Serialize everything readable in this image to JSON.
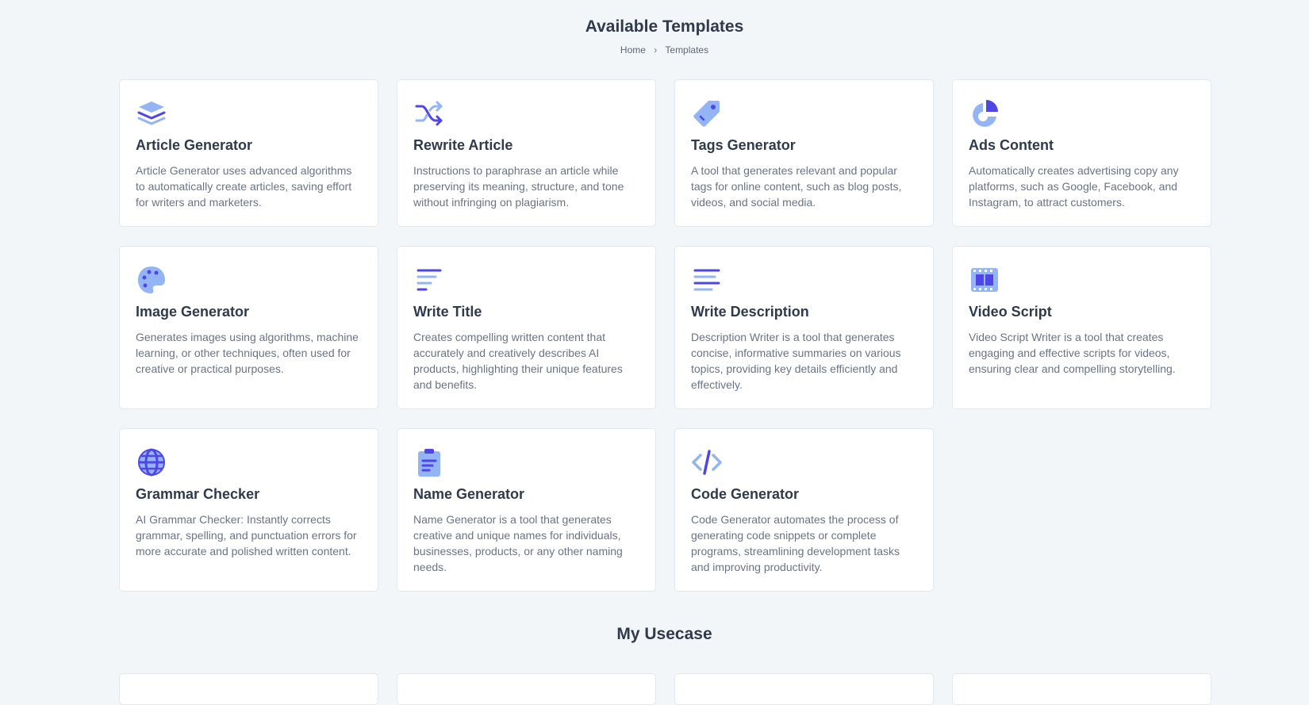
{
  "header": {
    "title": "Available Templates",
    "breadcrumb": {
      "home": "Home",
      "separator": "›",
      "current": "Templates"
    }
  },
  "colors": {
    "accent_dark": "#4f46e5",
    "accent_light": "#93b4f5",
    "background": "#f3f6f9",
    "card_border": "#e3e8ee"
  },
  "templates": [
    {
      "title": "Article Generator",
      "icon": "layers-icon",
      "description": "Article Generator uses advanced algorithms to automatically create articles, saving effort for writers and marketers."
    },
    {
      "title": "Rewrite Article",
      "icon": "shuffle-icon",
      "description": "Instructions to paraphrase an article while preserving its meaning, structure, and tone without infringing on plagiarism."
    },
    {
      "title": "Tags Generator",
      "icon": "tag-icon",
      "description": "A tool that generates relevant and popular tags for online content, such as blog posts, videos, and social media."
    },
    {
      "title": "Ads Content",
      "icon": "pie-chart-icon",
      "description": "Automatically creates advertising copy any platforms, such as Google, Facebook, and Instagram, to attract customers."
    },
    {
      "title": "Image Generator",
      "icon": "palette-icon",
      "description": "Generates images using algorithms, machine learning, or other techniques, often used for creative or practical purposes."
    },
    {
      "title": "Write Title",
      "icon": "text-lines-short-icon",
      "description": "Creates compelling written content that accurately and creatively describes AI products, highlighting their unique features and benefits."
    },
    {
      "title": "Write Description",
      "icon": "text-lines-icon",
      "description": "Description Writer is a tool that generates concise, informative summaries on various topics, providing key details efficiently and effectively."
    },
    {
      "title": "Video Script",
      "icon": "film-icon",
      "description": "Video Script Writer is a tool that creates engaging and effective scripts for videos, ensuring clear and compelling storytelling."
    },
    {
      "title": "Grammar Checker",
      "icon": "globe-icon",
      "description": "AI Grammar Checker: Instantly corrects grammar, spelling, and punctuation errors for more accurate and polished written content."
    },
    {
      "title": "Name Generator",
      "icon": "clipboard-icon",
      "description": "Name Generator is a tool that generates creative and unique names for individuals, businesses, products, or any other naming needs."
    },
    {
      "title": "Code Generator",
      "icon": "code-icon",
      "description": "Code Generator automates the process of generating code snippets or complete programs, streamlining development tasks and improving productivity."
    }
  ],
  "usecase": {
    "title": "My Usecase"
  }
}
